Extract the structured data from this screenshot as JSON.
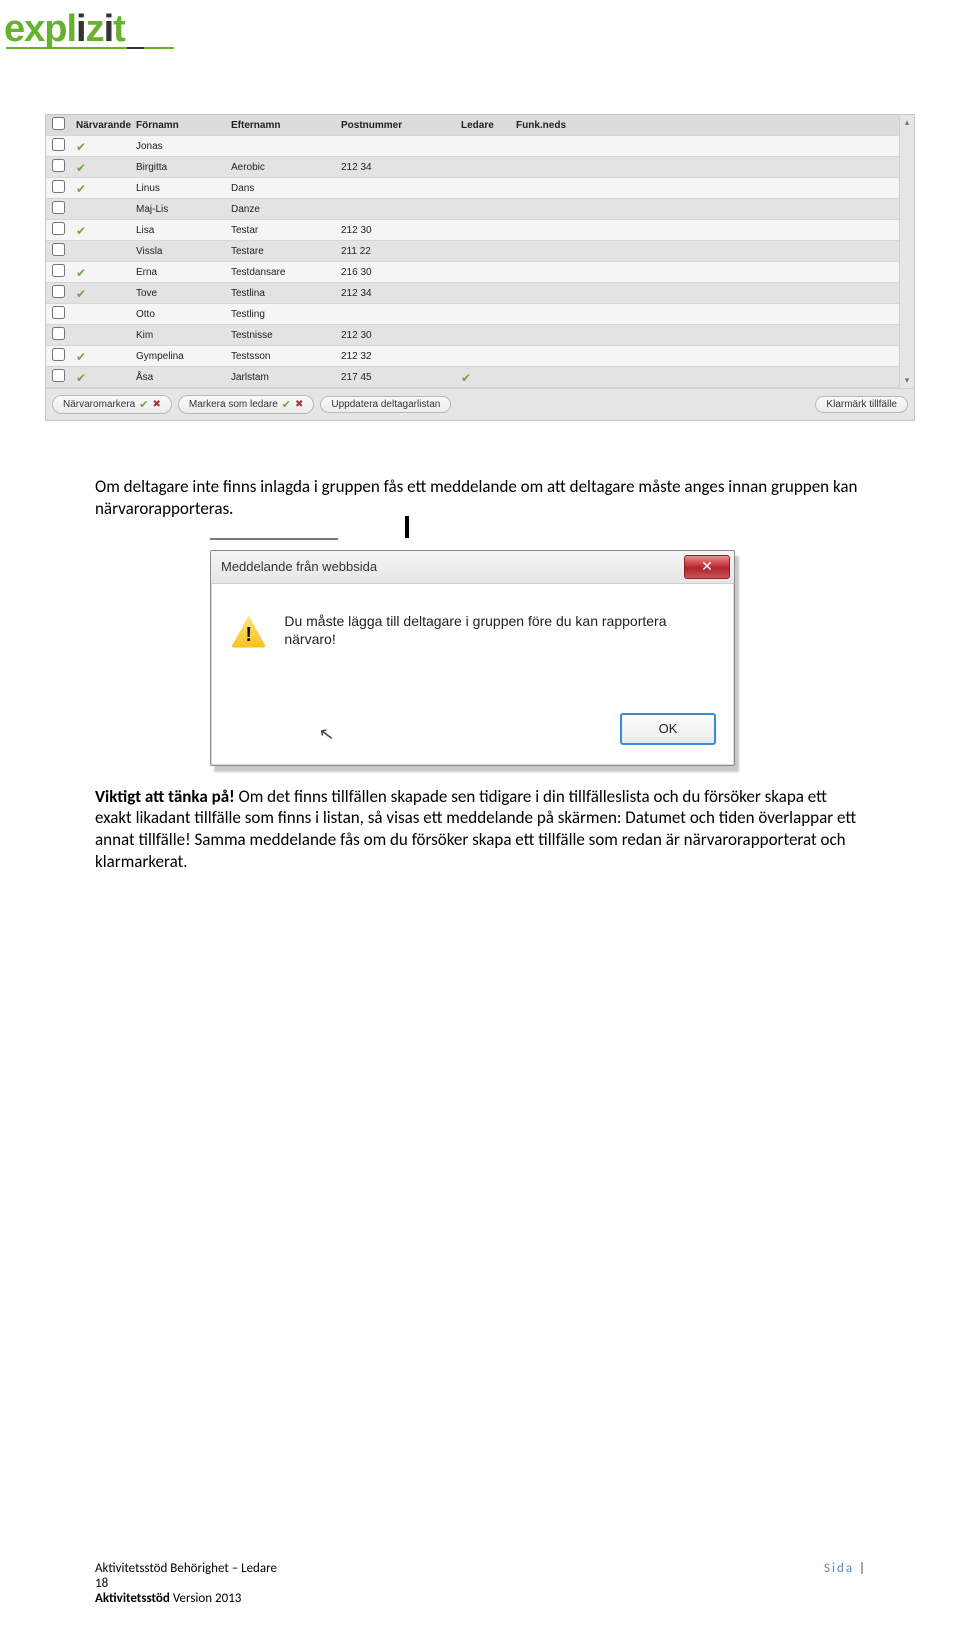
{
  "logo": "explizit",
  "table": {
    "headers": {
      "narvarande": "Närvarande",
      "fornamn": "Förnamn",
      "efternamn": "Efternamn",
      "postnummer": "Postnummer",
      "ledare": "Ledare",
      "funkneds": "Funk.neds"
    },
    "rows": [
      {
        "present": true,
        "fornamn": "Jonas",
        "efternamn": "",
        "postnummer": "",
        "ledare": false
      },
      {
        "present": true,
        "fornamn": "Birgitta",
        "efternamn": "Aerobic",
        "postnummer": "212 34",
        "ledare": false
      },
      {
        "present": true,
        "fornamn": "Linus",
        "efternamn": "Dans",
        "postnummer": "",
        "ledare": false
      },
      {
        "present": false,
        "fornamn": "Maj-Lis",
        "efternamn": "Danze",
        "postnummer": "",
        "ledare": false
      },
      {
        "present": true,
        "fornamn": "Lisa",
        "efternamn": "Testar",
        "postnummer": "212 30",
        "ledare": false
      },
      {
        "present": false,
        "fornamn": "Vissla",
        "efternamn": "Testare",
        "postnummer": "211 22",
        "ledare": false
      },
      {
        "present": true,
        "fornamn": "Erna",
        "efternamn": "Testdansare",
        "postnummer": "216 30",
        "ledare": false
      },
      {
        "present": true,
        "fornamn": "Tove",
        "efternamn": "Testlina",
        "postnummer": "212 34",
        "ledare": false
      },
      {
        "present": false,
        "fornamn": "Otto",
        "efternamn": "Testling",
        "postnummer": "",
        "ledare": false
      },
      {
        "present": false,
        "fornamn": "Kim",
        "efternamn": "Testnisse",
        "postnummer": "212 30",
        "ledare": false
      },
      {
        "present": true,
        "fornamn": "Gympelina",
        "efternamn": "Testsson",
        "postnummer": "212 32",
        "ledare": false
      },
      {
        "present": true,
        "fornamn": "Åsa",
        "efternamn": "Jarlstam",
        "postnummer": "217 45",
        "ledare": true
      }
    ],
    "buttons": {
      "narvaromarkera": "Närvaromarkera",
      "markera_ledare": "Markera som ledare",
      "uppdatera": "Uppdatera deltagarlistan",
      "klarmark": "Klarmärk tillfälle"
    }
  },
  "para1": "Om deltagare inte finns inlagda i gruppen fås ett meddelande om att deltagare måste anges innan gruppen kan närvarorapporteras.",
  "para2_heading": "Viktigt att tänka på!",
  "para2_body": " Om det finns tillfällen skapade sen tidigare i din tillfälleslista och du försöker skapa ett exakt likadant tillfälle som finns i listan, så visas ett meddelande på skärmen: Datumet och tiden överlappar ett annat tillfälle! Samma meddelande fås om du försöker skapa ett tillfälle som redan är närvarorapporterat och klarmarkerat.",
  "dialog": {
    "title": "Meddelande från webbsida",
    "message": "Du måste lägga till deltagare i gruppen före du kan rapportera närvaro!",
    "ok": "OK"
  },
  "footer": {
    "line1_left": "Aktivitetsstöd Behörighet – Ledare",
    "side_label": "Sida",
    "page_no": "18",
    "line3_bold": "Aktivitetsstöd",
    "line3_rest": " Version 2013"
  }
}
